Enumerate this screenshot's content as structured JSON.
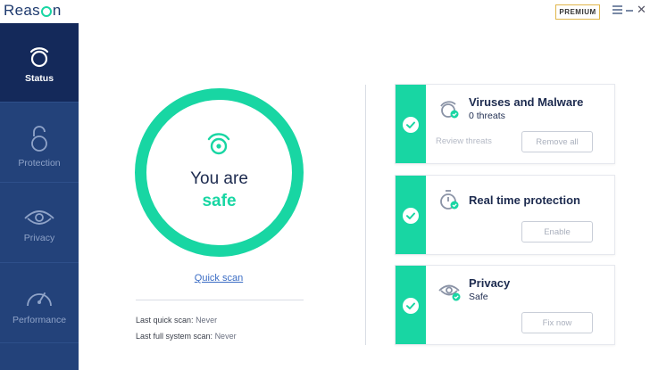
{
  "app": {
    "logo_pre": "Reas",
    "logo_post": "n",
    "premium_label": "PREMIUM"
  },
  "sidebar": {
    "items": [
      {
        "label": "Status",
        "icon": "status-icon",
        "active": true
      },
      {
        "label": "Protection",
        "icon": "lock-icon",
        "active": false
      },
      {
        "label": "Privacy",
        "icon": "eye-icon",
        "active": false
      },
      {
        "label": "Performance",
        "icon": "gauge-icon",
        "active": false
      }
    ]
  },
  "status": {
    "line1": "You are",
    "line2": "safe",
    "quick_scan": "Quick scan",
    "last_quick_label": "Last quick scan:",
    "last_quick_value": "Never",
    "last_full_label": "Last full system scan:",
    "last_full_value": "Never"
  },
  "cards": [
    {
      "title": "Viruses and Malware",
      "subtitle": "0 threats",
      "link": "Review threats",
      "button": "Remove all",
      "icon": "virus-shield-icon"
    },
    {
      "title": "Real time protection",
      "subtitle": "",
      "link": "",
      "button": "Enable",
      "icon": "stopwatch-icon"
    },
    {
      "title": "Privacy",
      "subtitle": "Safe",
      "link": "",
      "button": "Fix now",
      "icon": "eye-icon"
    }
  ],
  "colors": {
    "accent": "#18d6a3",
    "sidebar": "#23427a",
    "sidebar_active": "#14295a",
    "text_dark": "#1d2b4f",
    "premium_border": "#e0b64a"
  }
}
